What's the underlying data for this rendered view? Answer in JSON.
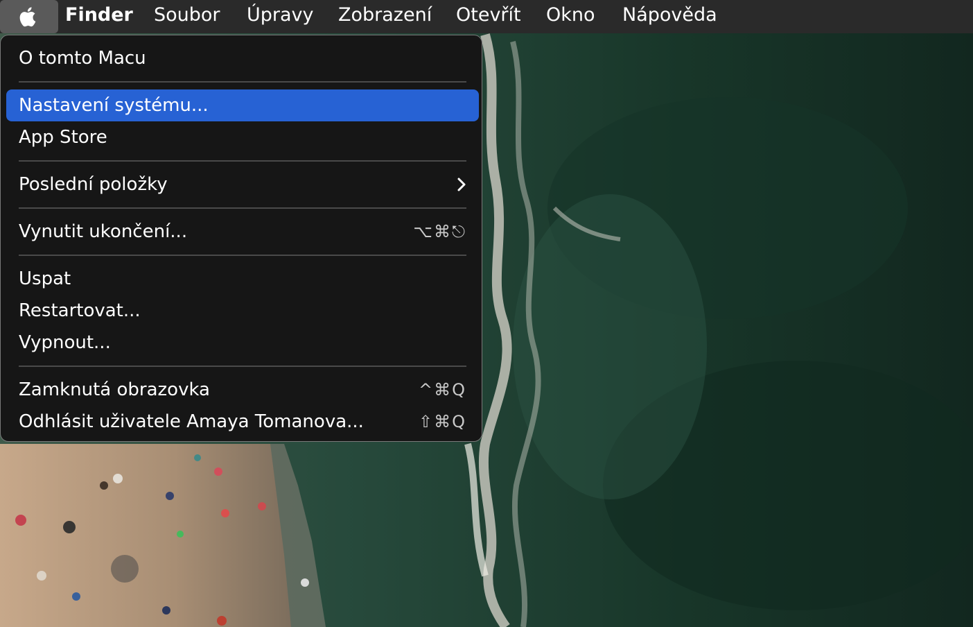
{
  "menubar": {
    "apple_icon": "apple-logo-icon",
    "app_name": "Finder",
    "items": [
      "Soubor",
      "Úpravy",
      "Zobrazení",
      "Otevřít",
      "Okno",
      "Nápověda"
    ]
  },
  "apple_menu": {
    "about": "O tomto Macu",
    "system_settings": "Nastavení systému...",
    "app_store": "App Store",
    "recent_items": "Poslední položky",
    "recent_items_icon": "chevron-right-icon",
    "force_quit": "Vynutit ukončení...",
    "force_quit_shortcut": "⌥⌘⎋",
    "sleep": "Uspat",
    "restart": "Restartovat...",
    "shut_down": "Vypnout...",
    "lock_screen": "Zamknutá obrazovka",
    "lock_screen_shortcut": "^⌘Q",
    "log_out": "Odhlásit uživatele Amaya Tomanova...",
    "log_out_shortcut": "⇧⌘Q"
  },
  "colors": {
    "menubar_bg": "#2a2a2a",
    "menu_bg": "#161616",
    "highlight": "#2762d4",
    "separator": "#4a4a4a",
    "text": "#ffffff",
    "shortcut_text": "#c9c9c9"
  }
}
